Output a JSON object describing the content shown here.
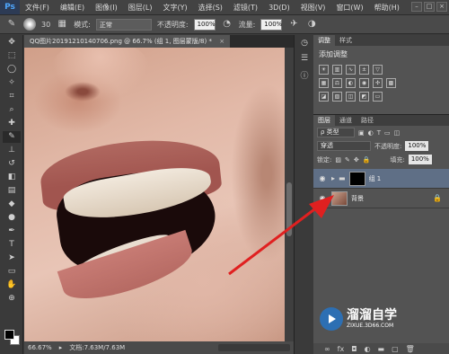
{
  "app": {
    "logo": "Ps"
  },
  "menubar": {
    "items": [
      "文件(F)",
      "编辑(E)",
      "图像(I)",
      "图层(L)",
      "文字(Y)",
      "选择(S)",
      "滤镜(T)",
      "3D(D)",
      "视图(V)",
      "窗口(W)",
      "帮助(H)"
    ]
  },
  "options": {
    "brush_size": "30",
    "mode_label": "模式:",
    "mode_value": "正常",
    "opacity_label": "不透明度:",
    "opacity_value": "100%",
    "flow_label": "流量:",
    "flow_value": "100%"
  },
  "document": {
    "tab_title": "QQ图片20191210140706.png @ 66.7% (组 1, 图层蒙版/8) *",
    "zoom": "66.67%",
    "doc_size": "文档:7.63M/7.63M"
  },
  "panels": {
    "adjust_tabs": [
      "调整",
      "样式"
    ],
    "adjust_title": "添加调整",
    "layer_tabs": [
      "图层",
      "通道",
      "路径"
    ],
    "kind_filter": "ρ 类型",
    "blend_mode": "穿透",
    "opacity_label": "不透明度:",
    "opacity_value": "100%",
    "lock_label": "锁定:",
    "fill_label": "填充:",
    "fill_value": "100%",
    "layers": [
      {
        "name": "组 1",
        "selected": true
      },
      {
        "name": "背景",
        "selected": false
      }
    ]
  },
  "watermark": {
    "name": "溜溜自学",
    "url": "ZIXUE.3D66.COM"
  }
}
